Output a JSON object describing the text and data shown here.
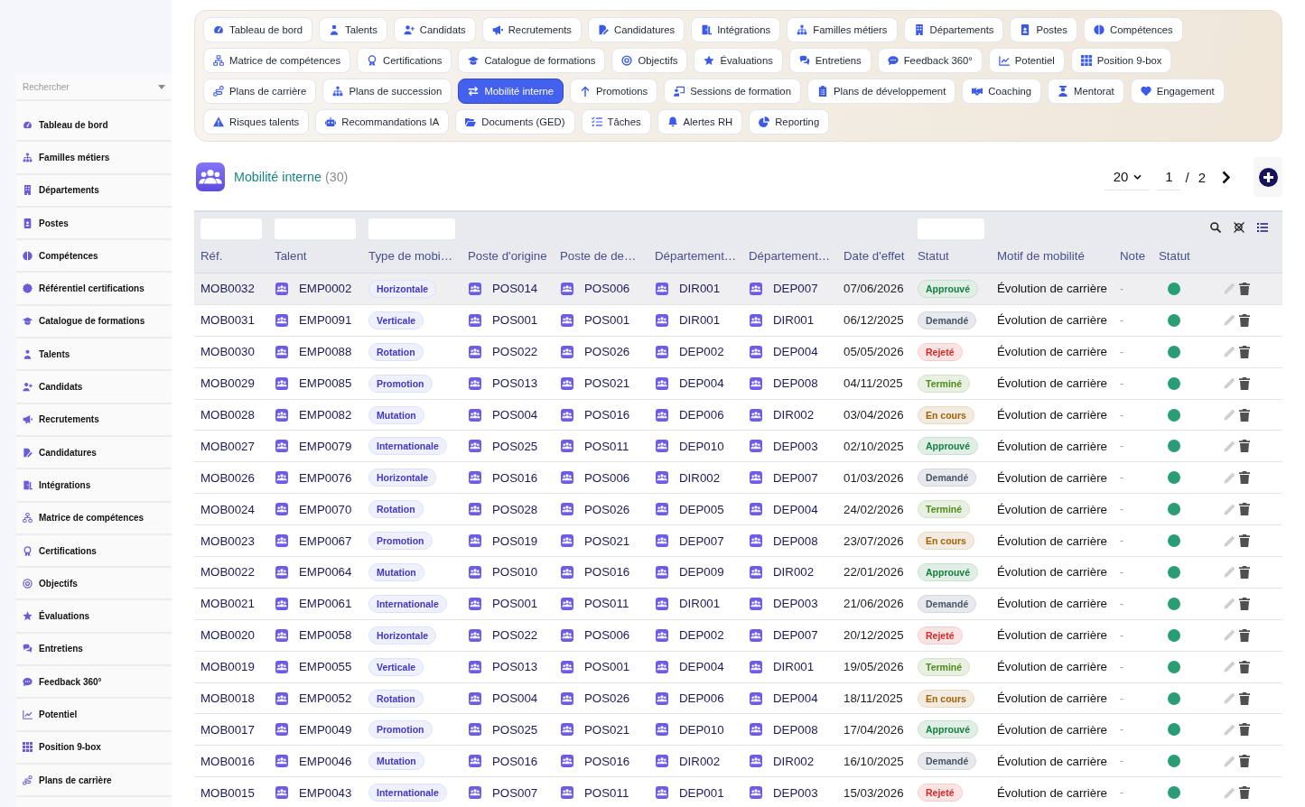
{
  "sidebar": {
    "search": {
      "placeholder": "Rechercher"
    },
    "items": [
      {
        "label": "Tableau de bord"
      },
      {
        "label": "Familles métiers"
      },
      {
        "label": "Départements"
      },
      {
        "label": "Postes"
      },
      {
        "label": "Compétences"
      },
      {
        "label": "Référentiel certifications"
      },
      {
        "label": "Catalogue de formations"
      },
      {
        "label": "Talents"
      },
      {
        "label": "Candidats"
      },
      {
        "label": "Recrutements"
      },
      {
        "label": "Candidatures"
      },
      {
        "label": "Intégrations"
      },
      {
        "label": "Matrice de compétences"
      },
      {
        "label": "Certifications"
      },
      {
        "label": "Objectifs"
      },
      {
        "label": "Évaluations"
      },
      {
        "label": "Entretiens"
      },
      {
        "label": "Feedback 360°"
      },
      {
        "label": "Potentiel"
      },
      {
        "label": "Position 9-box"
      },
      {
        "label": "Plans de carrière"
      }
    ]
  },
  "nav_rows": [
    [
      {
        "label": "Tableau de bord",
        "selected": false
      },
      {
        "label": "Talents",
        "selected": false
      },
      {
        "label": "Candidats",
        "selected": false
      },
      {
        "label": "Recrutements",
        "selected": false
      },
      {
        "label": "Candidatures",
        "selected": false
      },
      {
        "label": "Intégrations",
        "selected": false
      },
      {
        "label": "Familles métiers",
        "selected": false
      },
      {
        "label": "Départements",
        "selected": false
      },
      {
        "label": "Postes",
        "selected": false
      },
      {
        "label": "Compétences",
        "selected": false
      }
    ],
    [
      {
        "label": "Matrice de compétences",
        "selected": false
      },
      {
        "label": "Certifications",
        "selected": false
      },
      {
        "label": "Catalogue de formations",
        "selected": false
      },
      {
        "label": "Objectifs",
        "selected": false
      },
      {
        "label": "Évaluations",
        "selected": false
      },
      {
        "label": "Entretiens",
        "selected": false
      },
      {
        "label": "Feedback 360°",
        "selected": false
      },
      {
        "label": "Potentiel",
        "selected": false
      },
      {
        "label": "Position 9-box",
        "selected": false
      }
    ],
    [
      {
        "label": "Plans de carrière",
        "selected": false
      },
      {
        "label": "Plans de succession",
        "selected": false
      },
      {
        "label": "Mobilité interne",
        "selected": true
      },
      {
        "label": "Promotions",
        "selected": false
      },
      {
        "label": "Sessions de formation",
        "selected": false
      },
      {
        "label": "Plans de développement",
        "selected": false
      },
      {
        "label": "Coaching",
        "selected": false
      },
      {
        "label": "Mentorat",
        "selected": false
      },
      {
        "label": "Engagement",
        "selected": false
      }
    ],
    [
      {
        "label": "Risques talents",
        "selected": false
      },
      {
        "label": "Recommandations IA",
        "selected": false
      },
      {
        "label": "Documents (GED)",
        "selected": false
      },
      {
        "label": "Tâches",
        "selected": false
      },
      {
        "label": "Alertes RH",
        "selected": false
      },
      {
        "label": "Reporting",
        "selected": false
      }
    ]
  ],
  "header": {
    "title": "Mobilité interne",
    "count": "(30)",
    "page_size": "20",
    "page": "1",
    "separator": "/",
    "page_count": "2"
  },
  "table": {
    "columns": [
      {
        "label": "Réf.",
        "filter": true
      },
      {
        "label": "Talent",
        "filter": true
      },
      {
        "label": "Type de mobi…",
        "filter": true
      },
      {
        "label": "Poste d'origine",
        "filter": false
      },
      {
        "label": "Poste de de…",
        "filter": false
      },
      {
        "label": "Département…",
        "filter": false
      },
      {
        "label": "Département…",
        "filter": false
      },
      {
        "label": "Date d'effet",
        "filter": false
      },
      {
        "label": "Statut",
        "filter": true
      },
      {
        "label": "Motif de mobilité",
        "filter": false
      },
      {
        "label": "Note",
        "filter": false
      },
      {
        "label": "Statut",
        "filter": false
      }
    ],
    "rows": [
      {
        "ref": "MOB0032",
        "talent": "EMP0002",
        "type": "Horizontale",
        "origin_post": "POS014",
        "target_post": "POS006",
        "origin_dept": "DIR001",
        "target_dept": "DEP007",
        "date": "07/06/2026",
        "status": {
          "label": "Approuvé",
          "color": "#15803d"
        },
        "reason": "Évolution de carrière",
        "note": "-",
        "active": true,
        "highlighted": true
      },
      {
        "ref": "MOB0031",
        "talent": "EMP0091",
        "type": "Verticale",
        "origin_post": "POS001",
        "target_post": "POS001",
        "origin_dept": "DIR001",
        "target_dept": "DIR001",
        "date": "06/12/2025",
        "status": {
          "label": "Demandé",
          "color": "#475569"
        },
        "reason": "Évolution de carrière",
        "note": "-",
        "active": true,
        "highlighted": false
      },
      {
        "ref": "MOB0030",
        "talent": "EMP0088",
        "type": "Rotation",
        "origin_post": "POS022",
        "target_post": "POS026",
        "origin_dept": "DEP002",
        "target_dept": "DEP004",
        "date": "05/05/2026",
        "status": {
          "label": "Rejeté",
          "color": "#dc2626"
        },
        "reason": "Évolution de carrière",
        "note": "-",
        "active": true,
        "highlighted": false
      },
      {
        "ref": "MOB0029",
        "talent": "EMP0085",
        "type": "Promotion",
        "origin_post": "POS013",
        "target_post": "POS021",
        "origin_dept": "DEP004",
        "target_dept": "DEP008",
        "date": "04/11/2025",
        "status": {
          "label": "Terminé",
          "color": "#4d8c1a"
        },
        "reason": "Évolution de carrière",
        "note": "-",
        "active": true,
        "highlighted": false
      },
      {
        "ref": "MOB0028",
        "talent": "EMP0082",
        "type": "Mutation",
        "origin_post": "POS004",
        "target_post": "POS016",
        "origin_dept": "DEP006",
        "target_dept": "DIR002",
        "date": "03/04/2026",
        "status": {
          "label": "En cours",
          "color": "#a16207"
        },
        "reason": "Évolution de carrière",
        "note": "-",
        "active": true,
        "highlighted": false
      },
      {
        "ref": "MOB0027",
        "talent": "EMP0079",
        "type": "Internationale",
        "origin_post": "POS025",
        "target_post": "POS011",
        "origin_dept": "DEP010",
        "target_dept": "DEP003",
        "date": "02/10/2025",
        "status": {
          "label": "Approuvé",
          "color": "#15803d"
        },
        "reason": "Évolution de carrière",
        "note": "-",
        "active": true,
        "highlighted": false
      },
      {
        "ref": "MOB0026",
        "talent": "EMP0076",
        "type": "Horizontale",
        "origin_post": "POS016",
        "target_post": "POS006",
        "origin_dept": "DIR002",
        "target_dept": "DEP007",
        "date": "01/03/2026",
        "status": {
          "label": "Demandé",
          "color": "#475569"
        },
        "reason": "Évolution de carrière",
        "note": "-",
        "active": true,
        "highlighted": false
      },
      {
        "ref": "MOB0024",
        "talent": "EMP0070",
        "type": "Rotation",
        "origin_post": "POS028",
        "target_post": "POS026",
        "origin_dept": "DEP005",
        "target_dept": "DEP004",
        "date": "24/02/2026",
        "status": {
          "label": "Terminé",
          "color": "#4d8c1a"
        },
        "reason": "Évolution de carrière",
        "note": "-",
        "active": true,
        "highlighted": false
      },
      {
        "ref": "MOB0023",
        "talent": "EMP0067",
        "type": "Promotion",
        "origin_post": "POS019",
        "target_post": "POS021",
        "origin_dept": "DEP007",
        "target_dept": "DEP008",
        "date": "23/07/2026",
        "status": {
          "label": "En cours",
          "color": "#a16207"
        },
        "reason": "Évolution de carrière",
        "note": "-",
        "active": true,
        "highlighted": false
      },
      {
        "ref": "MOB0022",
        "talent": "EMP0064",
        "type": "Mutation",
        "origin_post": "POS010",
        "target_post": "POS016",
        "origin_dept": "DEP009",
        "target_dept": "DIR002",
        "date": "22/01/2026",
        "status": {
          "label": "Approuvé",
          "color": "#15803d"
        },
        "reason": "Évolution de carrière",
        "note": "-",
        "active": true,
        "highlighted": false
      },
      {
        "ref": "MOB0021",
        "talent": "EMP0061",
        "type": "Internationale",
        "origin_post": "POS001",
        "target_post": "POS011",
        "origin_dept": "DIR001",
        "target_dept": "DEP003",
        "date": "21/06/2026",
        "status": {
          "label": "Demandé",
          "color": "#475569"
        },
        "reason": "Évolution de carrière",
        "note": "-",
        "active": true,
        "highlighted": false
      },
      {
        "ref": "MOB0020",
        "talent": "EMP0058",
        "type": "Horizontale",
        "origin_post": "POS022",
        "target_post": "POS006",
        "origin_dept": "DEP002",
        "target_dept": "DEP007",
        "date": "20/12/2025",
        "status": {
          "label": "Rejeté",
          "color": "#dc2626"
        },
        "reason": "Évolution de carrière",
        "note": "-",
        "active": true,
        "highlighted": false
      },
      {
        "ref": "MOB0019",
        "talent": "EMP0055",
        "type": "Verticale",
        "origin_post": "POS013",
        "target_post": "POS001",
        "origin_dept": "DEP004",
        "target_dept": "DIR001",
        "date": "19/05/2026",
        "status": {
          "label": "Terminé",
          "color": "#4d8c1a"
        },
        "reason": "Évolution de carrière",
        "note": "-",
        "active": true,
        "highlighted": false
      },
      {
        "ref": "MOB0018",
        "talent": "EMP0052",
        "type": "Rotation",
        "origin_post": "POS004",
        "target_post": "POS026",
        "origin_dept": "DEP006",
        "target_dept": "DEP004",
        "date": "18/11/2025",
        "status": {
          "label": "En cours",
          "color": "#a16207"
        },
        "reason": "Évolution de carrière",
        "note": "-",
        "active": true,
        "highlighted": false
      },
      {
        "ref": "MOB0017",
        "talent": "EMP0049",
        "type": "Promotion",
        "origin_post": "POS025",
        "target_post": "POS021",
        "origin_dept": "DEP010",
        "target_dept": "DEP008",
        "date": "17/04/2026",
        "status": {
          "label": "Approuvé",
          "color": "#15803d"
        },
        "reason": "Évolution de carrière",
        "note": "-",
        "active": true,
        "highlighted": false
      },
      {
        "ref": "MOB0016",
        "talent": "EMP0046",
        "type": "Mutation",
        "origin_post": "POS016",
        "target_post": "POS016",
        "origin_dept": "DIR002",
        "target_dept": "DIR002",
        "date": "16/10/2025",
        "status": {
          "label": "Demandé",
          "color": "#475569"
        },
        "reason": "Évolution de carrière",
        "note": "-",
        "active": true,
        "highlighted": false
      },
      {
        "ref": "MOB0015",
        "talent": "EMP0043",
        "type": "Internationale",
        "origin_post": "POS007",
        "target_post": "POS011",
        "origin_dept": "DEP001",
        "target_dept": "DEP003",
        "date": "15/03/2026",
        "status": {
          "label": "Rejeté",
          "color": "#dc2626"
        },
        "reason": "Évolution de carrière",
        "note": "-",
        "active": true,
        "highlighted": false
      }
    ]
  }
}
